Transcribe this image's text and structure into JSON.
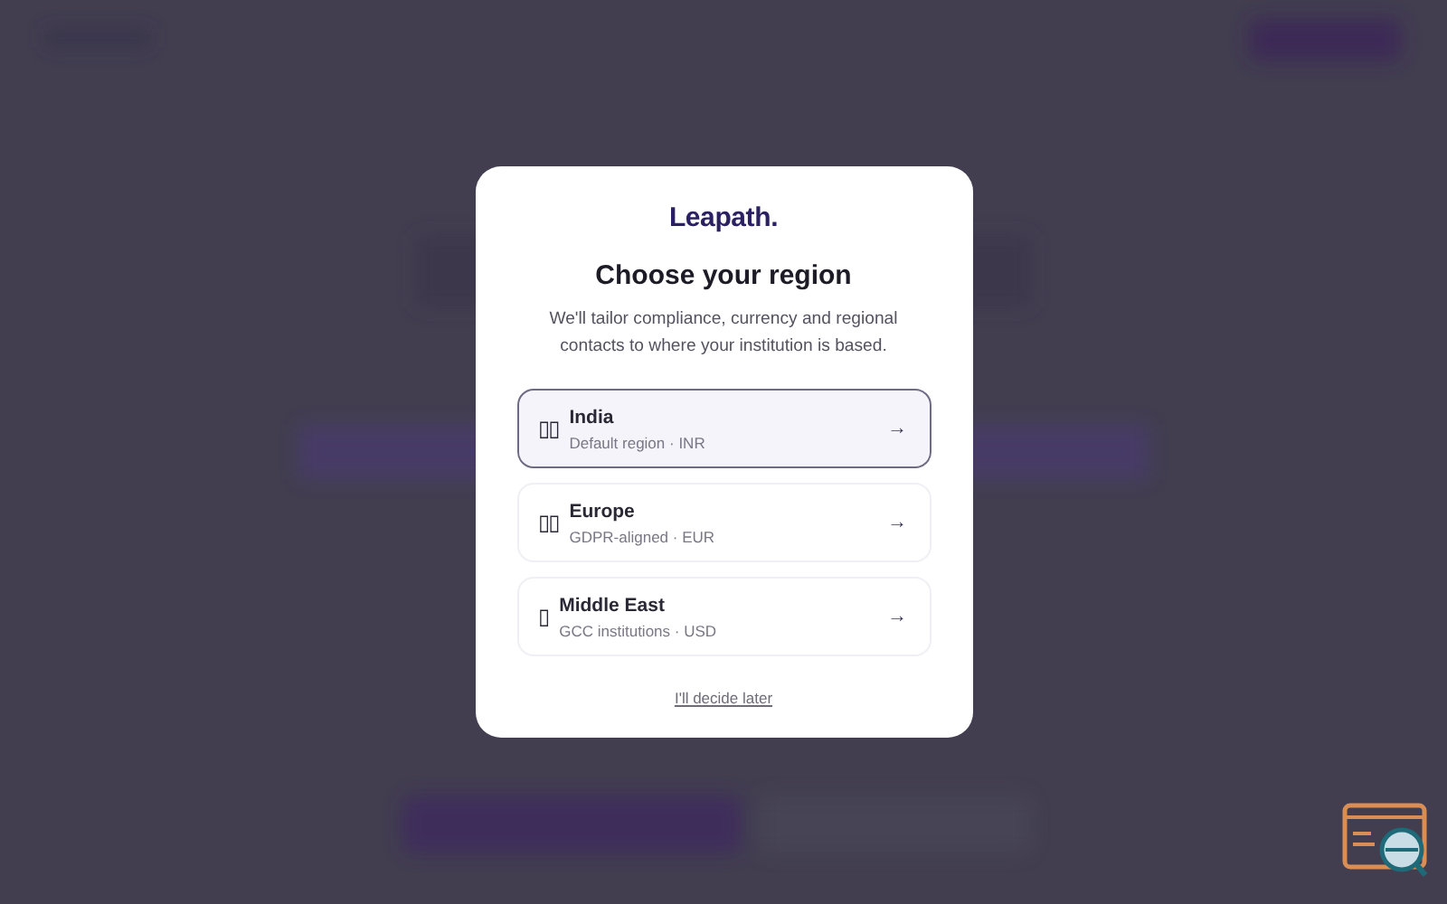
{
  "modal": {
    "logo": "Leapath.",
    "title": "Choose your region",
    "description": "We'll tailor compliance, currency and regional contacts to where your institution is based.",
    "regions": [
      {
        "name": "India",
        "detail": "Default region · INR",
        "arrow": "→",
        "glyphs": "▯▯",
        "selected": true
      },
      {
        "name": "Europe",
        "detail": "GDPR-aligned · EUR",
        "arrow": "→",
        "glyphs": "▯▯",
        "selected": false
      },
      {
        "name": "Middle East",
        "detail": "GCC institutions · USD",
        "arrow": "→",
        "glyphs": "▯",
        "selected": false
      }
    ],
    "skip_link": "I'll decide later"
  }
}
